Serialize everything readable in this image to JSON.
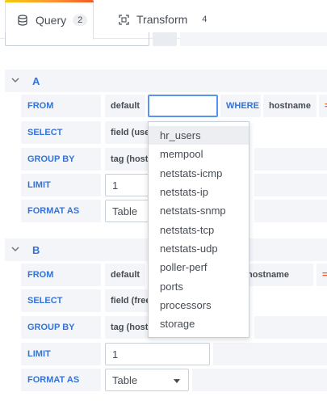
{
  "tabs": [
    {
      "label": "Query",
      "count": "2",
      "icon": "database-icon"
    },
    {
      "label": "Transform",
      "count": "4",
      "icon": "transform-icon"
    }
  ],
  "queries": [
    {
      "name": "A",
      "rows": {
        "from": {
          "label": "FROM",
          "policy": "default",
          "measurement_value": "",
          "where_kw": "WHERE",
          "tag": "hostname",
          "op": "="
        },
        "select": {
          "label": "SELECT",
          "value": "field (use"
        },
        "group_by": {
          "label": "GROUP BY",
          "value": "tag (hostn"
        },
        "limit": {
          "label": "LIMIT",
          "value": "1"
        },
        "format_as": {
          "label": "FORMAT AS",
          "value": "Table"
        }
      }
    },
    {
      "name": "B",
      "rows": {
        "from": {
          "label": "FROM",
          "policy": "default",
          "tag": "hostname",
          "op": "=~"
        },
        "select": {
          "label": "SELECT",
          "value": "field (free"
        },
        "group_by": {
          "label": "GROUP BY",
          "value": "tag (hostn"
        },
        "limit": {
          "label": "LIMIT",
          "value": "1"
        },
        "format_as": {
          "label": "FORMAT AS",
          "value": "Table"
        }
      }
    }
  ],
  "dropdown": {
    "highlighted": "hr_users",
    "items": [
      "hr_users",
      "mempool",
      "netstats-icmp",
      "netstats-ip",
      "netstats-snmp",
      "netstats-tcp",
      "netstats-udp",
      "poller-perf",
      "ports",
      "processors",
      "storage"
    ]
  }
}
